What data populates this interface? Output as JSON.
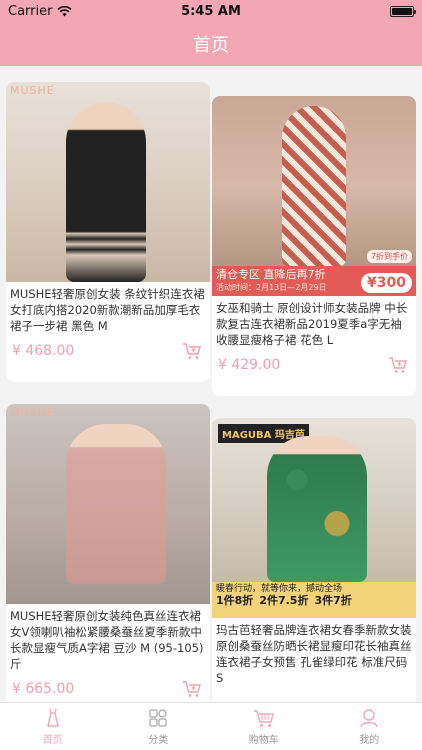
{
  "status_bar": {
    "carrier": "Carrier",
    "time": "5:45 AM"
  },
  "nav": {
    "title": "首页"
  },
  "products": [
    {
      "title": "MUSHE轻奢原创女装 条纹针织连衣裙女打底内搭2020新款潮新品加厚毛衣裙子一步裙 黑色 M",
      "price": "¥ 468.00",
      "brand_mark": "MUSHE"
    },
    {
      "title": "女巫和骑士 原创设计师女装品牌 中长款复古连衣裙新品2019夏季a字无袖收腰显瘦格子裙 花色 L",
      "price": "¥ 429.00",
      "promo_text": "清仓专区 直降后再7折",
      "promo_dates": "活动时间：2月13日—2月29日",
      "promo_price": "¥300",
      "promo_chip": "7折到手价"
    },
    {
      "title": "MUSHE轻奢原创女装纯色真丝连衣裙女V领喇叭袖松紧腰桑蚕丝夏季新款中长款显瘦气质A字裙 豆沙 M (95-105)斤",
      "price": "¥ 665.00",
      "brand_mark": "MUSHE"
    },
    {
      "title": "玛古芭轻奢品牌连衣裙女春季新款女装原创桑蚕丝防晒长裙显瘦印花长袖真丝连衣裙子女预售 孔雀绿印花 标准尺码 S",
      "price": "",
      "brand_mark": "MAGUBA 玛吉芭",
      "promo_line": "暖春行动，就等你来，撼动全场",
      "promo_1": "1件8折",
      "promo_2": "2件7.5折",
      "promo_3": "3件7折"
    }
  ],
  "tabs": [
    {
      "label": "首页",
      "active": true
    },
    {
      "label": "分类",
      "active": false
    },
    {
      "label": "购物车",
      "active": false
    },
    {
      "label": "我的",
      "active": false
    }
  ],
  "colors": {
    "accent": "#f2a7b2",
    "price": "#f0a0ac",
    "tab_inactive": "#999999"
  }
}
